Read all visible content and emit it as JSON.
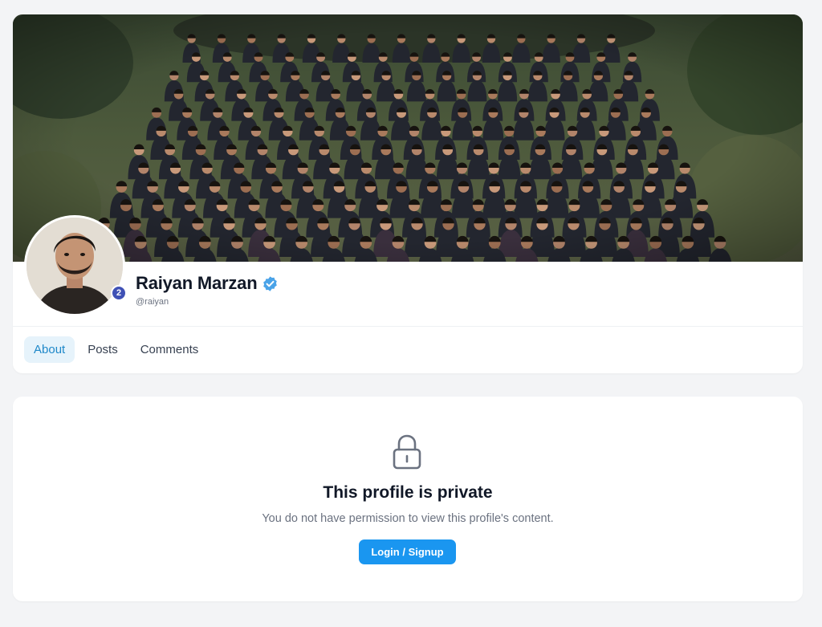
{
  "profile": {
    "cover_alt": "Group photo cover",
    "name": "Raiyan Marzan",
    "handle": "@raiyan",
    "verified": true,
    "avatar_badge": "2"
  },
  "tabs": [
    {
      "label": "About",
      "active": true
    },
    {
      "label": "Posts",
      "active": false
    },
    {
      "label": "Comments",
      "active": false
    }
  ],
  "private_notice": {
    "icon": "lock-icon",
    "title": "This profile is private",
    "message": "You do not have permission to view this profile's content.",
    "button_label": "Login / Signup"
  },
  "colors": {
    "accent": "#1a96f0",
    "tab_active_bg": "#e6f3fb",
    "tab_active_text": "#1e88c9",
    "verified": "#4aa3e8",
    "badge": "#3f51b5",
    "page_bg": "#f3f4f6"
  }
}
